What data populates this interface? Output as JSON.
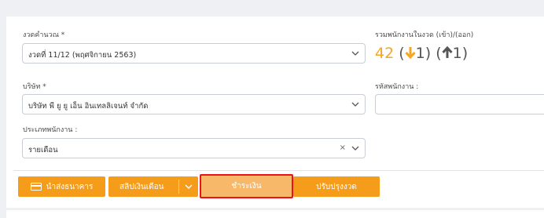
{
  "form": {
    "period_label": "งวดคำนวณ *",
    "period_value": "งวดที่ 11/12 (พฤศจิกายน 2563)",
    "company_label": "บริษัท *",
    "company_value": "บริษัท พี ยู ยู เอ็น อินเทลลิเจนท์ จำกัด",
    "emptype_label": "ประเภทพนักงาน :",
    "emptype_value": "รายเดือน",
    "empcode_label": "รหัสพนักงาน :",
    "empcode_value": ""
  },
  "summary": {
    "title": "รวมพนักงานในงวด (เข้า)/(ออก)",
    "total": "42",
    "in_count": "1",
    "out_count": "1"
  },
  "toolbar": {
    "bank_label": "นำส่งธนาคาร",
    "payslip_label": "สลิปเงินเดือน",
    "pay_label": "ชำระเงิน",
    "adjust_label": "ปรับปรุงงวด"
  },
  "colors": {
    "accent": "#f59c1a",
    "highlight_border": "#e8141c",
    "count_color": "#f5a623"
  }
}
